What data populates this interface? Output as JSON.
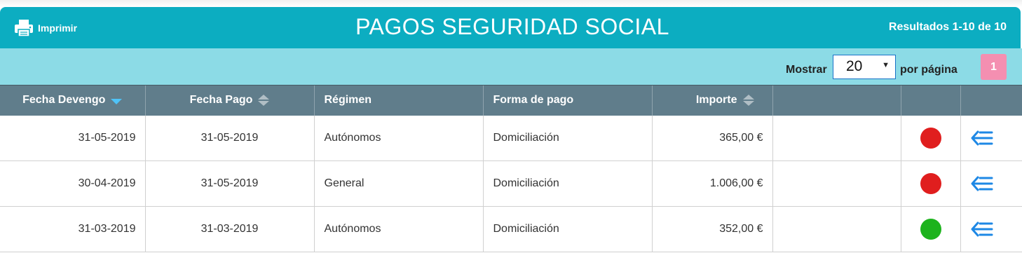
{
  "header": {
    "print_label": "Imprimir",
    "title": "PAGOS SEGURIDAD SOCIAL",
    "results": "Resultados 1-10 de 10"
  },
  "toolbar": {
    "show_label": "Mostrar",
    "per_page_value": "20",
    "per_page_suffix": "por página",
    "current_page": "1"
  },
  "table": {
    "columns": [
      "Fecha Devengo",
      "Fecha Pago",
      "Régimen",
      "Forma de pago",
      "Importe",
      "",
      "",
      ""
    ],
    "rows": [
      {
        "fecha_devengo": "31-05-2019",
        "fecha_pago": "31-05-2019",
        "regimen": "Autónomos",
        "forma_pago": "Domiciliación",
        "importe": "365,00 €",
        "status": "red"
      },
      {
        "fecha_devengo": "30-04-2019",
        "fecha_pago": "31-05-2019",
        "regimen": "General",
        "forma_pago": "Domiciliación",
        "importe": "1.006,00 €",
        "status": "red"
      },
      {
        "fecha_devengo": "31-03-2019",
        "fecha_pago": "31-03-2019",
        "regimen": "Autónomos",
        "forma_pago": "Domiciliación",
        "importe": "352,00 €",
        "status": "green"
      }
    ]
  },
  "colors": {
    "header_bg": "#0cadc1",
    "toolbar_bg": "#8cdbe6",
    "table_head_bg": "#607d8b",
    "page_button": "#f48fb1",
    "status_red": "#e01e1e",
    "status_green": "#1db31d",
    "action_icon": "#1e88e5"
  },
  "icons": {
    "print": "printer-icon",
    "sort_active": "sort-desc-icon",
    "sort_inactive": "sort-both-icon",
    "status": "status-dot-icon",
    "action": "detail-arrow-icon"
  }
}
